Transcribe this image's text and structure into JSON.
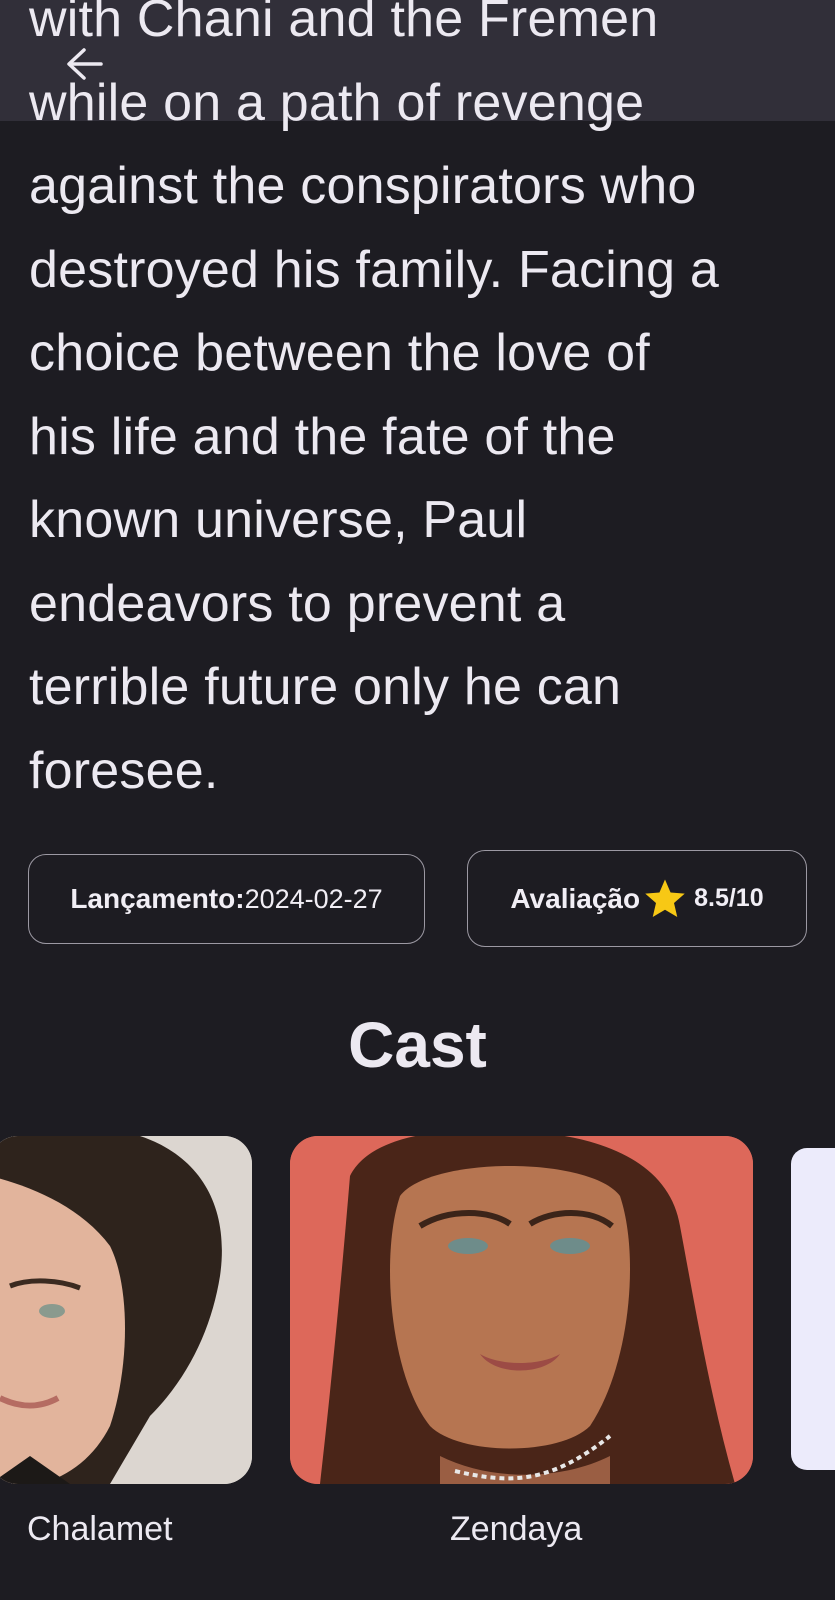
{
  "navigation": {
    "back_icon": "arrow-left-icon"
  },
  "overview": {
    "text": "with Chani and the Fremen\nwhile on a path of revenge\nagainst the conspirators who\ndestroyed his family. Facing a\nchoice between the love of\nhis life and the fate of the\nknown universe, Paul\nendeavors to prevent a\nterrible future only he can\nforesee."
  },
  "info": {
    "release_label": "Lançamento:",
    "release_value": "2024-02-27",
    "rating_label": "Avaliação",
    "rating_value": "8.5/10",
    "star_icon": "star-icon",
    "star_color": "#f7c815"
  },
  "cast": {
    "title": "Cast",
    "members": [
      {
        "name": "Chalamet",
        "photo_bg": "#d9d4ce"
      },
      {
        "name": "Zendaya",
        "photo_bg": "#dd685a"
      },
      {
        "name": "",
        "photo_bg": "#ecebfb"
      }
    ]
  },
  "colors": {
    "background": "#1d1c22",
    "text": "#ece9f1",
    "chip_border": "#9c99a3",
    "topbar": "#383642"
  }
}
